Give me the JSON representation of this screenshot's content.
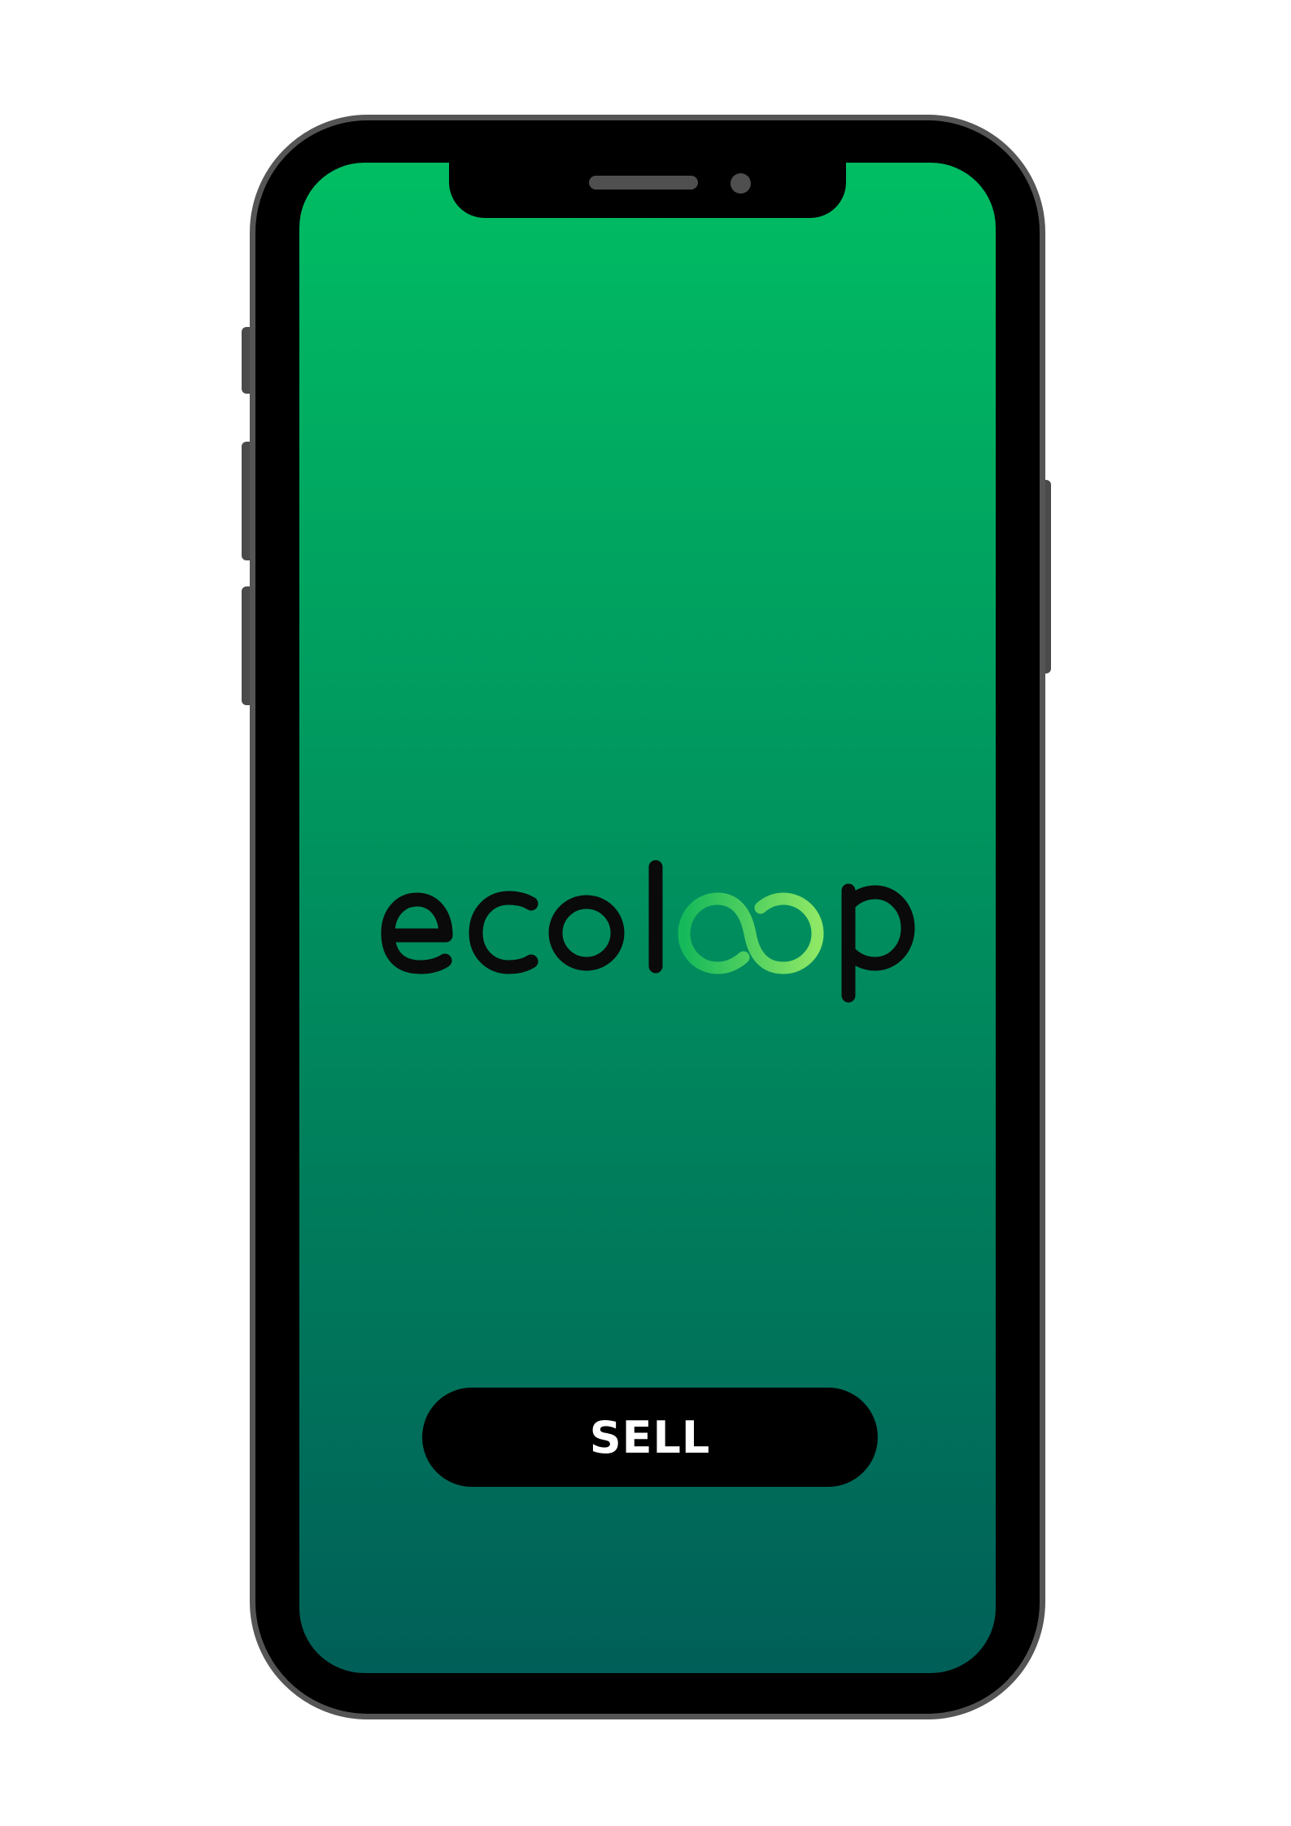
{
  "app": {
    "brand_name": "ecoloop"
  },
  "colors": {
    "screen_gradient_top": "#00bd63",
    "screen_gradient_bottom": "#005f58",
    "frame": "#000000",
    "frame_border": "#555555",
    "logo_text": "#0a0a0a",
    "logo_loop_start": "#16b95a",
    "logo_loop_end": "#8ee866",
    "button_bg": "#000000",
    "button_text": "#ffffff"
  },
  "actions": {
    "sell_label": "SELL"
  },
  "icons": {
    "logo": "ecoloop-logo",
    "speaker": "speaker-grille",
    "camera": "front-camera"
  }
}
